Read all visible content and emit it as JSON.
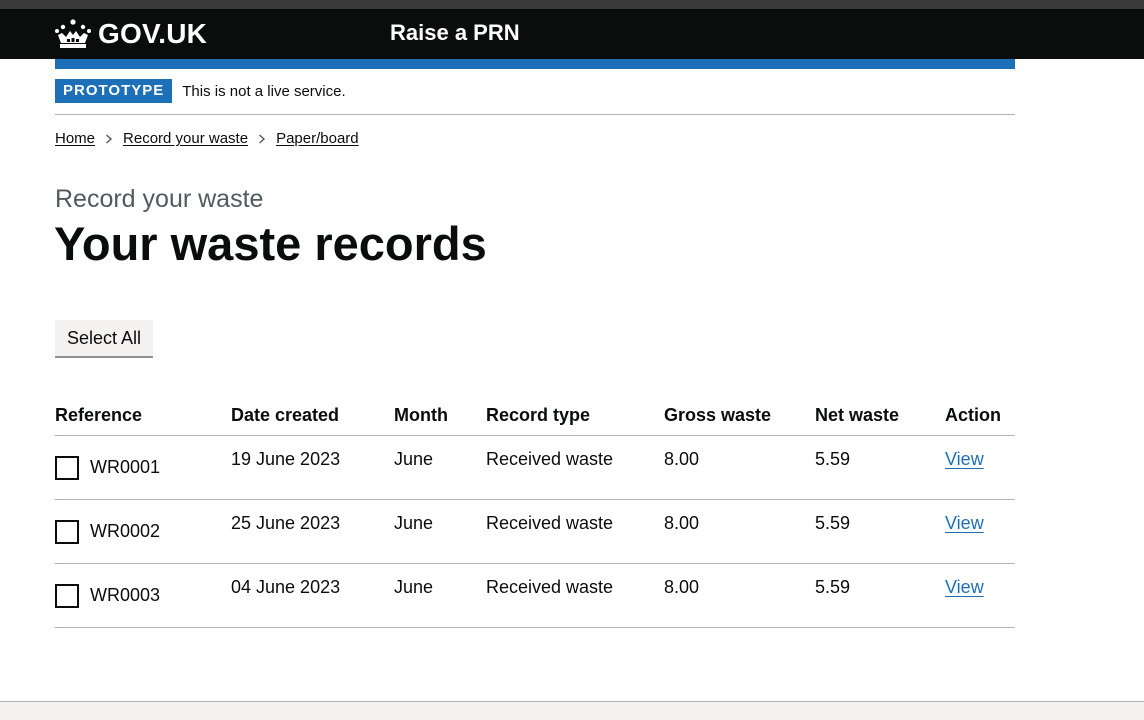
{
  "header": {
    "logo_text": "GOV.UK",
    "service_name": "Raise a PRN"
  },
  "phase_banner": {
    "tag": "PROTOTYPE",
    "text": "This is not a live service."
  },
  "breadcrumbs": [
    "Home",
    "Record your waste",
    "Paper/board"
  ],
  "page": {
    "caption": "Record your waste",
    "title": "Your waste records",
    "select_all_label": "Select All"
  },
  "table": {
    "headers": [
      "Reference",
      "Date created",
      "Month",
      "Record type",
      "Gross waste",
      "Net waste",
      "Action"
    ],
    "rows": [
      {
        "reference": "WR0001",
        "date_created": "19 June 2023",
        "month": "June",
        "record_type": "Received waste",
        "gross_waste": "8.00",
        "net_waste": "5.59",
        "action": "View"
      },
      {
        "reference": "WR0002",
        "date_created": "25 June 2023",
        "month": "June",
        "record_type": "Received waste",
        "gross_waste": "8.00",
        "net_waste": "5.59",
        "action": "View"
      },
      {
        "reference": "WR0003",
        "date_created": "04 June 2023",
        "month": "June",
        "record_type": "Received waste",
        "gross_waste": "8.00",
        "net_waste": "5.59",
        "action": "View"
      }
    ]
  },
  "icons": {
    "logo": "crown-icon",
    "breadcrumb_separator": "chevron-right-icon"
  },
  "colors": {
    "header_bg": "#0b0c0c",
    "brand_blue": "#1d70b8",
    "link": "#1d70b8",
    "caption_grey": "#505a5f",
    "border": "#b1b4b6"
  }
}
